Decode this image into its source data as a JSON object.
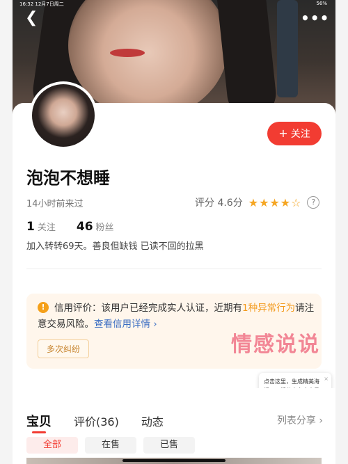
{
  "status_bar": {
    "time": "16:32  12月7日周二",
    "right": "56%"
  },
  "profile": {
    "name": "泡泡不想睡",
    "last_seen": "14小时前来过",
    "rating_label": "评分 4.6分",
    "rating_value": 4.6,
    "stars": "★★★★☆",
    "follow_label": "关注",
    "following_count": "1",
    "following_label": "关注",
    "followers_count": "46",
    "followers_label": "粉丝",
    "bio": "加入转转69天。善良但缺钱  已读不回的拉黑"
  },
  "credit": {
    "prefix": "信用评价：",
    "text1": "该用户已经完成实人认证，近期有",
    "highlight": "1种异常行为",
    "text2": "请注意交易风险。",
    "link": "查看信用详情",
    "tag": "多次纠纷"
  },
  "watermark": "情感说说",
  "tooltip": {
    "text": "点击这里，生成精美海报，一键分享多个宝贝",
    "close": "×"
  },
  "tabs": [
    {
      "label": "宝贝"
    },
    {
      "label": "评价(36)"
    },
    {
      "label": "动态"
    }
  ],
  "share_label": "列表分享",
  "filters": [
    {
      "label": "全部"
    },
    {
      "label": "在售"
    },
    {
      "label": "已售"
    }
  ],
  "colors": {
    "accent": "#f23c32",
    "credit_highlight": "#f39a1c",
    "link": "#3b6dc2"
  }
}
